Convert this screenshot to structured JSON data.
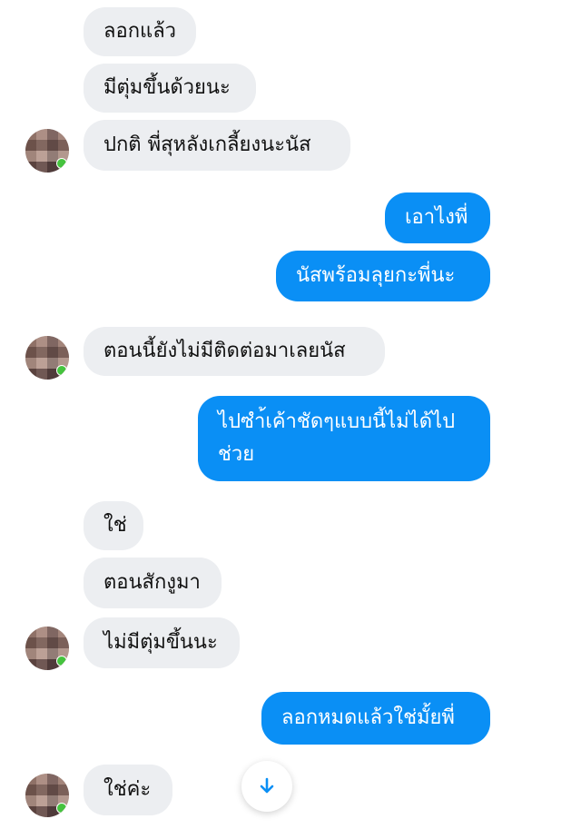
{
  "messages": [
    {
      "side": "in",
      "text": "ลอกแล้ว"
    },
    {
      "side": "in",
      "text": "มีตุ่มขึ้นด้วยนะ"
    },
    {
      "side": "in",
      "text": "ปกติ พี่สุหลังเกลี้ยงนะนัส"
    },
    {
      "side": "out",
      "text": "เอาไงพี่"
    },
    {
      "side": "out",
      "text": "นัสพร้อมลุยกะพี่นะ"
    },
    {
      "side": "in",
      "text": "ตอนนี้ยังไม่มีติดต่อมาเลยนัส"
    },
    {
      "side": "out",
      "text": "ไปซำ้เค้าชัดๆแบบนี้ไม่ได้ไป ช่วย"
    },
    {
      "side": "in",
      "text": "ใช่"
    },
    {
      "side": "in",
      "text": "ตอนสักงูมา"
    },
    {
      "side": "in",
      "text": "ไม่มีตุ่มขึ้นนะ"
    },
    {
      "side": "out",
      "text": "ลอกหมดแล้วใช่มั้ยพี่"
    },
    {
      "side": "in",
      "text": "ใช่ค่ะ"
    }
  ],
  "colors": {
    "outgoing_bubble": "#0a8ff5",
    "incoming_bubble": "#eceef1",
    "online_dot": "#45c33e"
  },
  "icons": {
    "scroll_down": "arrow-down-icon"
  }
}
